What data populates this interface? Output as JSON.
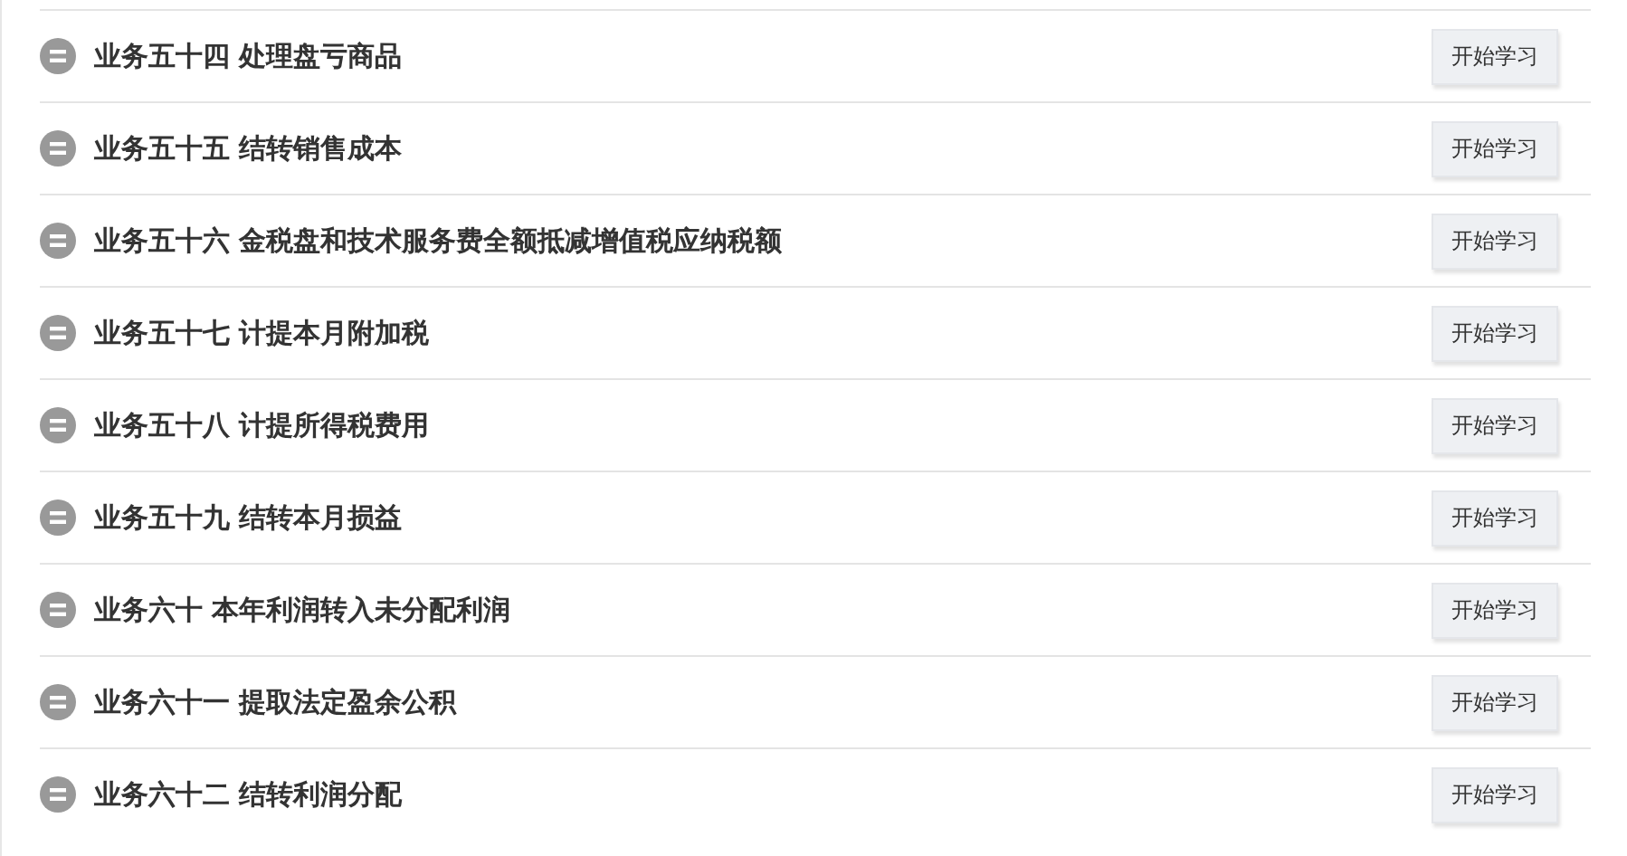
{
  "lessons": [
    {
      "title": "业务五十四 处理盘亏商品",
      "button": "开始学习"
    },
    {
      "title": "业务五十五 结转销售成本",
      "button": "开始学习"
    },
    {
      "title": "业务五十六 金税盘和技术服务费全额抵减增值税应纳税额",
      "button": "开始学习"
    },
    {
      "title": "业务五十七 计提本月附加税",
      "button": "开始学习"
    },
    {
      "title": "业务五十八 计提所得税费用",
      "button": "开始学习"
    },
    {
      "title": "业务五十九 结转本月损益",
      "button": "开始学习"
    },
    {
      "title": "业务六十 本年利润转入未分配利润",
      "button": "开始学习"
    },
    {
      "title": "业务六十一 提取法定盈余公积",
      "button": "开始学习"
    },
    {
      "title": "业务六十二 结转利润分配",
      "button": "开始学习"
    }
  ]
}
